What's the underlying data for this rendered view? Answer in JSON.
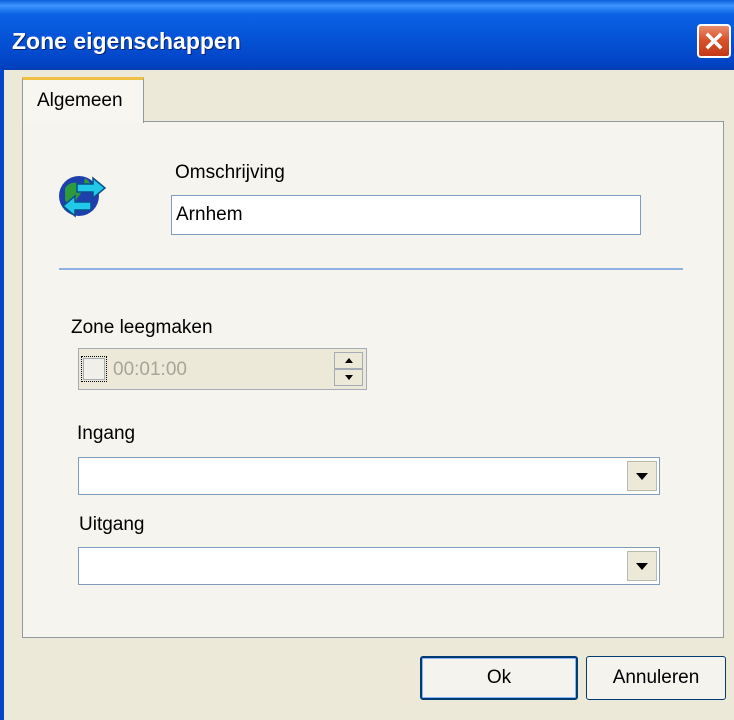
{
  "window": {
    "title": "Zone eigenschappen"
  },
  "tabs": [
    {
      "label": "Algemeen",
      "active": true
    }
  ],
  "general": {
    "description_label": "Omschrijving",
    "description_value": "Arnhem",
    "clear_zone_label": "Zone leegmaken",
    "clear_zone_checked": false,
    "clear_zone_time": "00:01:00",
    "entrance_label": "Ingang",
    "entrance_value": "",
    "exit_label": "Uitgang",
    "exit_value": ""
  },
  "buttons": {
    "ok": "Ok",
    "cancel": "Annuleren"
  },
  "icons": {
    "zone": "globe-arrows-icon",
    "close": "close-icon"
  },
  "colors": {
    "titlebar": "#0553d6",
    "close_button": "#d9532a",
    "separator": "#8db2e3"
  }
}
